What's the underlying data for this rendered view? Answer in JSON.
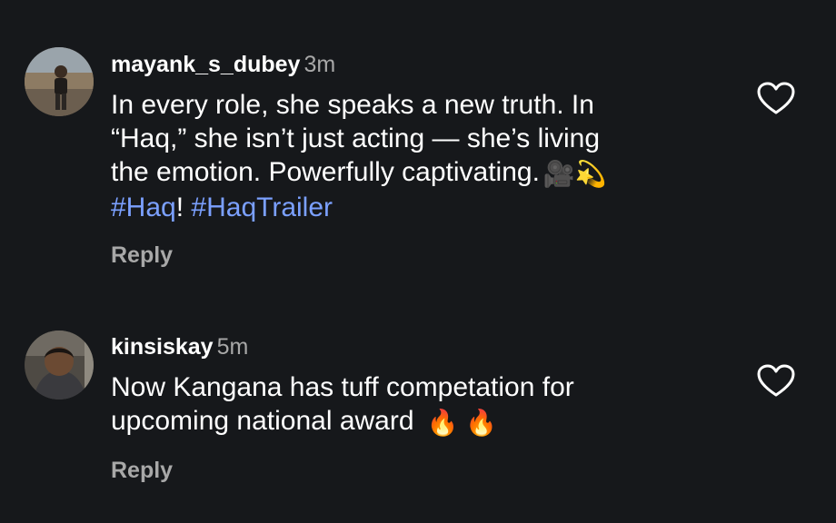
{
  "comments": [
    {
      "username": "mayank_s_dubey",
      "time": "3m",
      "lines": [
        "In every role, she speaks a new truth. In",
        "“Haq,” she isn’t just acting — she’s living",
        "the emotion. Powerfully captivating."
      ],
      "emojis_line3": "🎥💫",
      "hashtag1": "#Haq",
      "hashtag_sep": "!",
      "hashtag2": "#HaqTrailer",
      "reply_label": "Reply",
      "like_icon": "heart-outline-icon"
    },
    {
      "username": "kinsiskay",
      "time": "5m",
      "lines": [
        "Now Kangana has tuff competation for",
        "upcoming national award"
      ],
      "emojis_line2": "🔥 🔥",
      "reply_label": "Reply",
      "like_icon": "heart-outline-icon"
    }
  ],
  "colors": {
    "background": "#16181b",
    "text": "#ffffff",
    "secondary": "#a8a8a8",
    "hashtag": "#7ba0ff"
  }
}
